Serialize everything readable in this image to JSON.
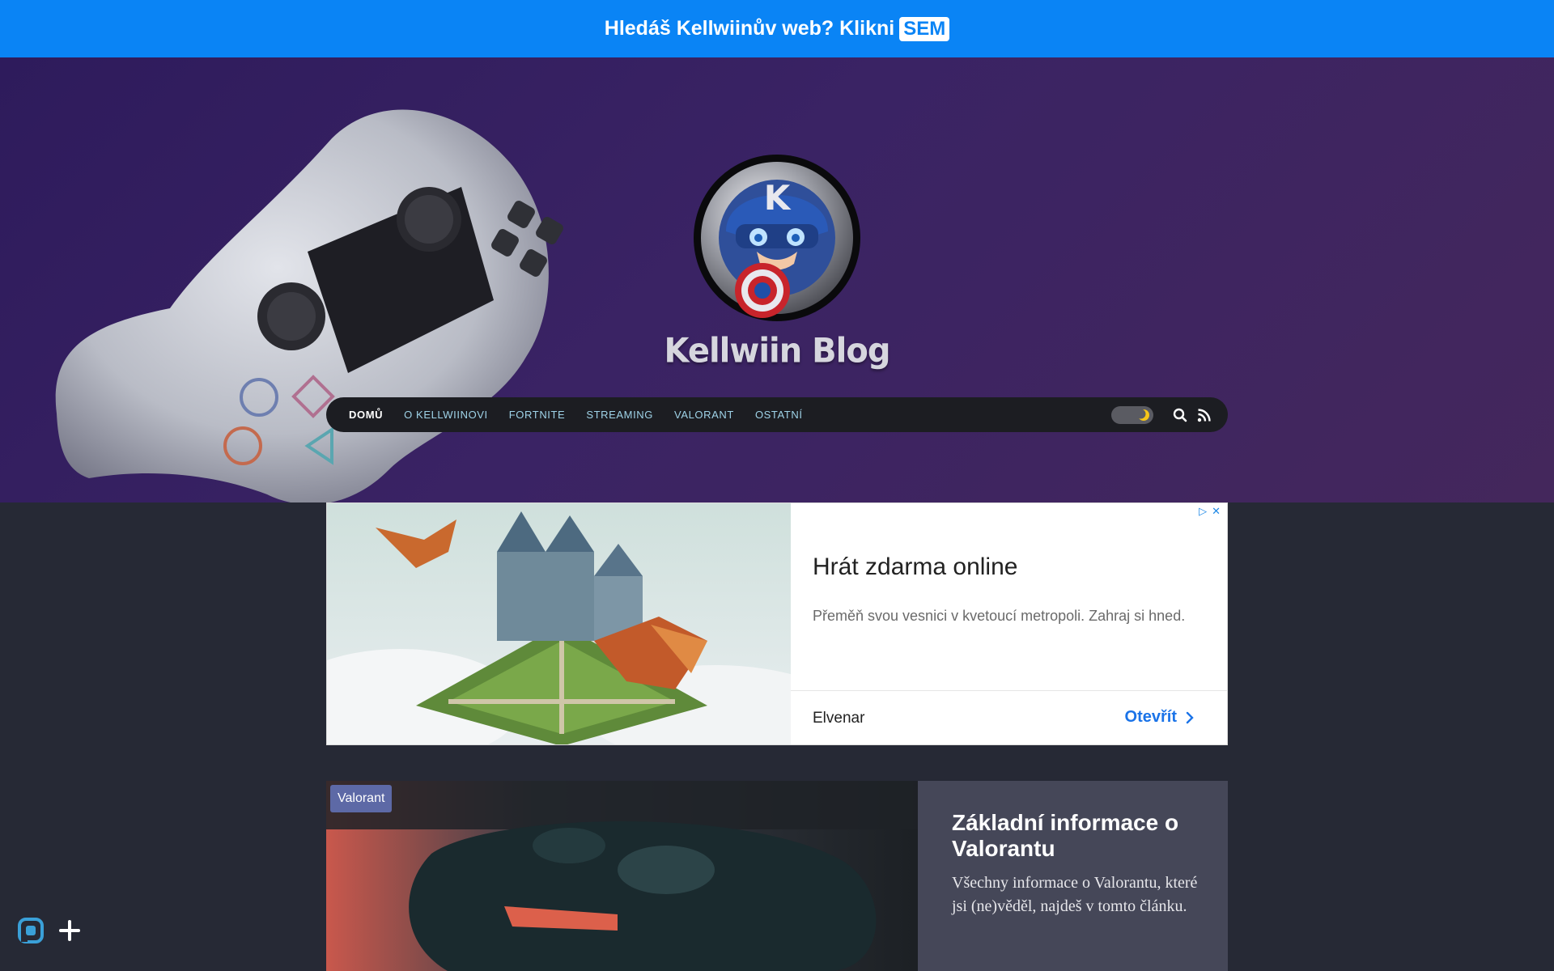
{
  "banner": {
    "text": "Hledáš Kellwiinův web? Klikni",
    "link_label": "SEM"
  },
  "hero": {
    "blog_title": "Kellwiin Blog",
    "avatar_letter": "K"
  },
  "nav": {
    "items": [
      {
        "label": "DOMŮ",
        "active": true
      },
      {
        "label": "O KELLWIINOVI",
        "active": false
      },
      {
        "label": "FORTNITE",
        "active": false
      },
      {
        "label": "STREAMING",
        "active": false
      },
      {
        "label": "VALORANT",
        "active": false
      },
      {
        "label": "OSTATNÍ",
        "active": false
      }
    ],
    "icons": [
      "dark-mode-toggle",
      "search-icon",
      "rss-icon"
    ]
  },
  "ad": {
    "title": "Hrát zdarma online",
    "description": "Přeměň svou vesnici v kvetoucí metropoli. Zahraj si hned.",
    "brand": "Elvenar",
    "cta": "Otevřít"
  },
  "article": {
    "tag": "Valorant",
    "title": "Základní informace o Valorantu",
    "excerpt": "Všechny informace o Valorantu, které jsi (ne)věděl, najdeš v tomto článku."
  },
  "colors": {
    "banner": "#0a84f5",
    "nav_link": "#9fd3e8",
    "page_bg": "#262935",
    "card_body": "#454758",
    "tag": "#5d69a6",
    "ad_cta": "#1a73e8"
  }
}
